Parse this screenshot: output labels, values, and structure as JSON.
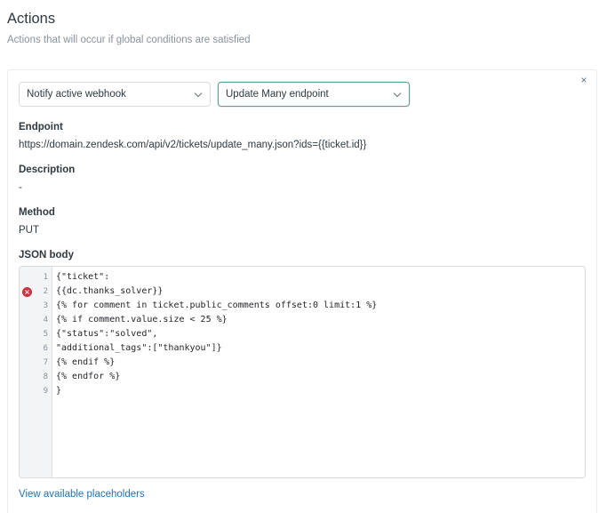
{
  "section": {
    "title": "Actions",
    "subtitle": "Actions that will occur if global conditions are satisfied"
  },
  "card": {
    "close_icon": "×",
    "action_select": {
      "value": "Notify active webhook"
    },
    "endpoint_select": {
      "value": "Update Many endpoint"
    },
    "endpoint": {
      "label": "Endpoint",
      "value": "https://domain.zendesk.com/api/v2/tickets/update_many.json?ids={{ticket.id}}"
    },
    "description": {
      "label": "Description",
      "value": "-"
    },
    "method": {
      "label": "Method",
      "value": "PUT"
    },
    "json_body": {
      "label": "JSON body",
      "error_line": 2,
      "lines": [
        {
          "num": "1",
          "code": "{\"ticket\":"
        },
        {
          "num": "2",
          "code": "{{dc.thanks_solver}}"
        },
        {
          "num": "3",
          "code": "{% for comment in ticket.public_comments offset:0 limit:1 %}"
        },
        {
          "num": "4",
          "code": "{% if comment.value.size < 25 %}"
        },
        {
          "num": "5",
          "code": "{\"status\":\"solved\","
        },
        {
          "num": "6",
          "code": "\"additional_tags\":[\"thankyou\"]}"
        },
        {
          "num": "7",
          "code": "{% endif %}"
        },
        {
          "num": "8",
          "code": "{% endfor %}"
        },
        {
          "num": "9",
          "code": "}"
        }
      ]
    },
    "placeholders_link": "View available placeholders"
  },
  "colors": {
    "error": "#cc3340",
    "link": "#1f73b7",
    "focus_border": "#5e9c8f"
  }
}
